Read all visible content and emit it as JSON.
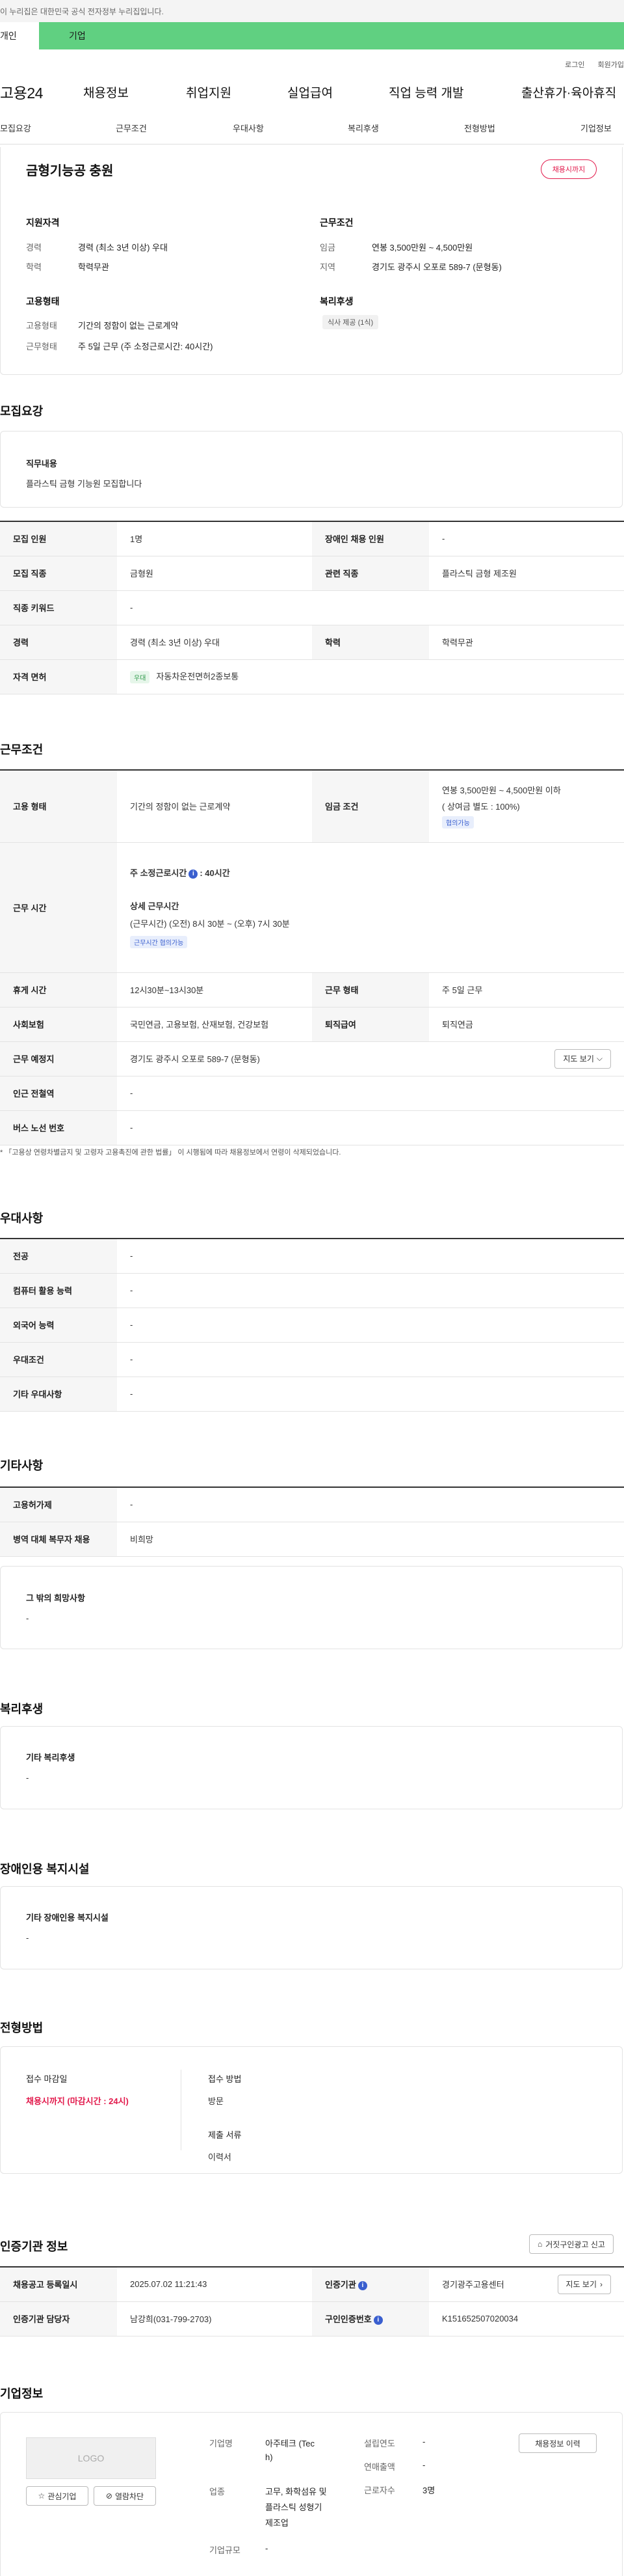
{
  "notice": "이 누리집은 대한민국 공식 전자정부 누리집입니다.",
  "user_tabs": [
    "개인",
    "기업"
  ],
  "util": [
    "로그인",
    "회원가입"
  ],
  "gnb": {
    "logo": "고용24",
    "menus": [
      "채용정보",
      "취업지원",
      "실업급여",
      "직업 능력 개발",
      "출산휴가·육아휴직"
    ]
  },
  "subnav": [
    "모집요강",
    "근무조건",
    "우대사항",
    "복리후생",
    "전형방법",
    "기업정보"
  ],
  "job": {
    "title": "금형기능공 충원",
    "deadline": "채용시까지"
  },
  "summary": {
    "qual_title": "지원자격",
    "career_label": "경력",
    "career_value": "경력 (최소 3년 이상) 우대",
    "edu_label": "학력",
    "edu_value": "학력무관",
    "work_title": "근무조건",
    "wage_label": "임금",
    "wage_value": "연봉 3,500만원 ~ 4,500만원",
    "region_label": "지역",
    "region_value": "경기도 광주시 오포로 589-7 (문형동)",
    "emp_title": "고용형태",
    "emptype_label": "고용형태",
    "emptype_value": "기간의 정함이 없는 근로계약",
    "worktype_label": "근무형태",
    "worktype_value": "주 5일 근무 (주 소정근로시간: 40시간)",
    "welfare_title": "복리후생",
    "welfare_tag": "식사 제공 (1식)"
  },
  "recruit": {
    "title": "모집요강",
    "duty_label": "직무내용",
    "duty_value": "플라스틱 금형 기능원 모집합니다",
    "rows": {
      "count_k": "모집 인원",
      "count_v": "1명",
      "disabled_k": "장애인 채용 인원",
      "disabled_v": "-",
      "job_k": "모집 직종",
      "job_v": "금형원",
      "related_k": "관련 직종",
      "related_v": "플라스틱 금형 제조원",
      "keyword_k": "직종 키워드",
      "keyword_v": "-",
      "career_k": "경력",
      "career_v": "경력 (최소 3년 이상) 우대",
      "edu_k": "학력",
      "edu_v": "학력무관",
      "license_k": "자격 면허",
      "license_chip": "우대",
      "license_v": "자동차운전면허2종보통"
    }
  },
  "work": {
    "title": "근무조건",
    "emptype_k": "고용 형태",
    "emptype_v": "기간의 정함이 없는 근로계약",
    "wage_k": "임금 조건",
    "wage_v": "연봉 3,500만원 ~ 4,500만원 이하",
    "wage_sub": "( 상여금 별도 : 100%)",
    "wage_chip": "협의가능",
    "hours_k": "근무 시간",
    "hours_main_a": "주 소정근로시간",
    "hours_main_b": ": 40시간",
    "hours_detail_title": "상세 근무시간",
    "hours_detail": "(근무시간) (오전) 8시 30분 ~ (오후) 7시 30분",
    "hours_chip": "근무시간 협의가능",
    "rest_k": "휴게 시간",
    "rest_v": "12시30분~13시30분",
    "worktype_k": "근무 형태",
    "worktype_v": "주 5일 근무",
    "insurance_k": "사회보험",
    "insurance_v": "국민연금, 고용보험, 산재보험, 건강보험",
    "severance_k": "퇴직급여",
    "severance_v": "퇴직연금",
    "place_k": "근무 예정지",
    "place_v": "경기도 광주시 오포로 589-7 (문형동)",
    "map_button": "지도 보기",
    "subway_k": "인근 전철역",
    "subway_v": "-",
    "bus_k": "버스 노선 번호",
    "bus_v": "-",
    "footnote": "* 「고용상 연령차별금지 및 고령자 고용촉진에 관한 법률」 이 시행됨에 따라 채용정보에서 연령이 삭제되었습니다."
  },
  "prefer": {
    "title": "우대사항",
    "rows": [
      {
        "k": "전공",
        "v": "-"
      },
      {
        "k": "컴퓨터 활용 능력",
        "v": "-"
      },
      {
        "k": "외국어 능력",
        "v": "-"
      },
      {
        "k": "우대조건",
        "v": "-"
      },
      {
        "k": "기타 우대사항",
        "v": "-"
      }
    ]
  },
  "etc": {
    "title": "기타사항",
    "rows": [
      {
        "k": "고용허가제",
        "v": "-"
      },
      {
        "k": "병역 대체 복무자 채용",
        "v": "비희망"
      }
    ],
    "other_label": "그 밖의 희망사항",
    "other_value": "-"
  },
  "welfare": {
    "title": "복리후생",
    "label": "기타 복리후생",
    "value": "-"
  },
  "disability": {
    "title": "장애인용 복지시설",
    "label": "기타 장애인용 복지시설",
    "value": "-"
  },
  "process": {
    "title": "전형방법",
    "deadline_label": "접수 마감일",
    "deadline_value": "채용시까지 (마감시간 : 24시)",
    "method_label": "접수 방법",
    "method_value": "방문",
    "docs_label": "제출 서류",
    "docs_value": "이력서"
  },
  "agency": {
    "title": "인증기관 정보",
    "report_button": "거짓구인광고 신고",
    "reg_k": "채용공고 등록일시",
    "reg_v": "2025.07.02 11:21:43",
    "org_k": "인증기관",
    "org_v": "경기광주고용센터",
    "map_button": "지도 보기",
    "staff_k": "인증기관 담당자",
    "staff_v": "남강희(031-799-2703)",
    "cert_k": "구인인증번호",
    "cert_v": "K151652507020034"
  },
  "company": {
    "title": "기업정보",
    "logo_text": "LOGO",
    "fav_button": "관심기업",
    "block_button": "열람차단",
    "history_button": "채용정보 이력",
    "name_k": "기업명",
    "name_v1": "아주테크 (Tec",
    "name_v2": "h)",
    "industry_k": "업종",
    "industry_v1": "고무, 화학섬유 및",
    "industry_v2": "플라스틱 성형기",
    "industry_v3": "제조업",
    "size_k": "기업규모",
    "size_v": "-",
    "founded_k": "설립연도",
    "founded_v": "-",
    "sales_k": "연매출액",
    "sales_v": "-",
    "employees_k": "근로자수",
    "employees_v": "3명"
  }
}
